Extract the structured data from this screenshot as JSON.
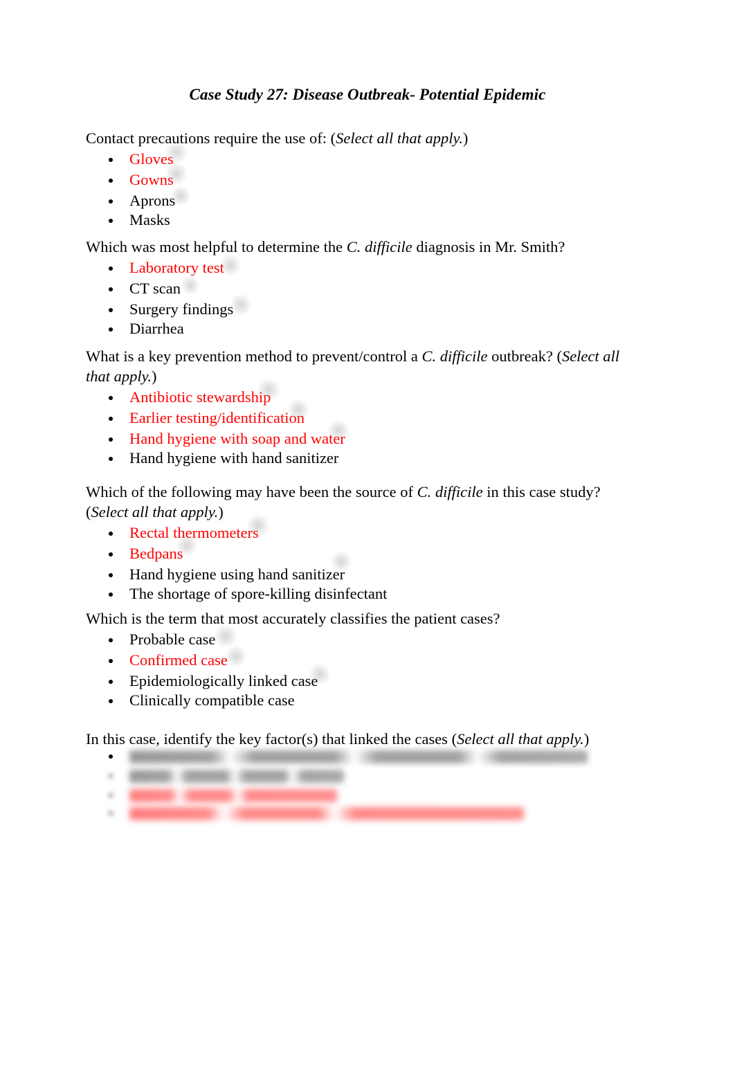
{
  "document": {
    "title": "Case Study 27: Disease Outbreak- Potential Epidemic",
    "answer_color": "#FF0000",
    "text_color": "#000000",
    "page_background": "#FFFFFF"
  },
  "questions": [
    {
      "id": "q1",
      "prompt_plain": "Contact precautions require the use of: (Select all that apply.)",
      "prompt_parts": [
        {
          "text": "Contact precautions require the use of: (",
          "italic": false
        },
        {
          "text": "Select all that apply.",
          "italic": true
        },
        {
          "text": ")",
          "italic": false
        }
      ],
      "options": [
        {
          "label": "Gloves",
          "selected": true
        },
        {
          "label": "Gowns",
          "selected": true
        },
        {
          "label": "Aprons",
          "selected": false
        },
        {
          "label": "Masks",
          "selected": false
        }
      ]
    },
    {
      "id": "q2",
      "prompt_plain": "Which was most helpful to determine the C. difficile diagnosis in Mr. Smith?",
      "prompt_parts": [
        {
          "text": "Which was most helpful to determine the ",
          "italic": false
        },
        {
          "text": "C. difficile",
          "italic": true
        },
        {
          "text": " diagnosis in Mr. Smith?",
          "italic": false
        }
      ],
      "options": [
        {
          "label": "Laboratory test",
          "selected": true
        },
        {
          "label": "CT scan",
          "selected": false
        },
        {
          "label": "Surgery findings",
          "selected": false
        },
        {
          "label": "Diarrhea",
          "selected": false
        }
      ]
    },
    {
      "id": "q3",
      "prompt_plain": "What is a key prevention method to prevent/control a C. difficile outbreak? (Select all that apply.)",
      "prompt_parts": [
        {
          "text": "What is a key prevention method to prevent/control a ",
          "italic": false
        },
        {
          "text": "C. difficile",
          "italic": true
        },
        {
          "text": " outbreak? (",
          "italic": false
        },
        {
          "text": "Select all that apply.",
          "italic": true
        },
        {
          "text": ")",
          "italic": false
        }
      ],
      "options": [
        {
          "label": "Antibiotic stewardship",
          "selected": true
        },
        {
          "label": "Earlier testing/identification",
          "selected": true
        },
        {
          "label": "Hand hygiene with soap and water",
          "selected": true
        },
        {
          "label": "Hand hygiene with hand sanitizer",
          "selected": false
        }
      ]
    },
    {
      "id": "q4",
      "prompt_plain": "Which of the following may have been the source of C. difficile in this case study? (Select all that apply.)",
      "prompt_parts": [
        {
          "text": "Which of the following may have been the source of ",
          "italic": false
        },
        {
          "text": "C. difficile",
          "italic": true
        },
        {
          "text": " in this case study? (",
          "italic": false
        },
        {
          "text": "Select all that apply.",
          "italic": true
        },
        {
          "text": ")",
          "italic": false
        }
      ],
      "options": [
        {
          "label": "Rectal thermometers",
          "selected": true
        },
        {
          "label": "Bedpans",
          "selected": true
        },
        {
          "label": "Hand hygiene using hand sanitizer",
          "selected": false
        },
        {
          "label": "The shortage of spore-killing disinfectant",
          "selected": false
        }
      ]
    },
    {
      "id": "q5",
      "prompt_plain": "Which is the term that most accurately classifies the patient cases?",
      "prompt_parts": [
        {
          "text": "Which is the term that most accurately classifies the patient cases?",
          "italic": false
        }
      ],
      "options": [
        {
          "label": "Probable case",
          "selected": false
        },
        {
          "label": "Confirmed case",
          "selected": true
        },
        {
          "label": "Epidemiologically linked case",
          "selected": false
        },
        {
          "label": "Clinically compatible case",
          "selected": false
        }
      ]
    },
    {
      "id": "q6",
      "prompt_plain": "In this case, identify the key factor(s) that linked the cases (Select all that apply.)",
      "prompt_parts": [
        {
          "text": "In this case, identify the key factor(s) that linked the cases (",
          "italic": false
        },
        {
          "text": "Select all that apply.",
          "italic": true
        },
        {
          "text": ")",
          "italic": false
        }
      ],
      "options_redacted": true,
      "options": [
        {
          "label": "",
          "selected": false,
          "redacted": true
        },
        {
          "label": "",
          "selected": false,
          "redacted": true
        },
        {
          "label": "",
          "selected": true,
          "redacted": true
        },
        {
          "label": "",
          "selected": true,
          "redacted": true
        }
      ]
    }
  ]
}
